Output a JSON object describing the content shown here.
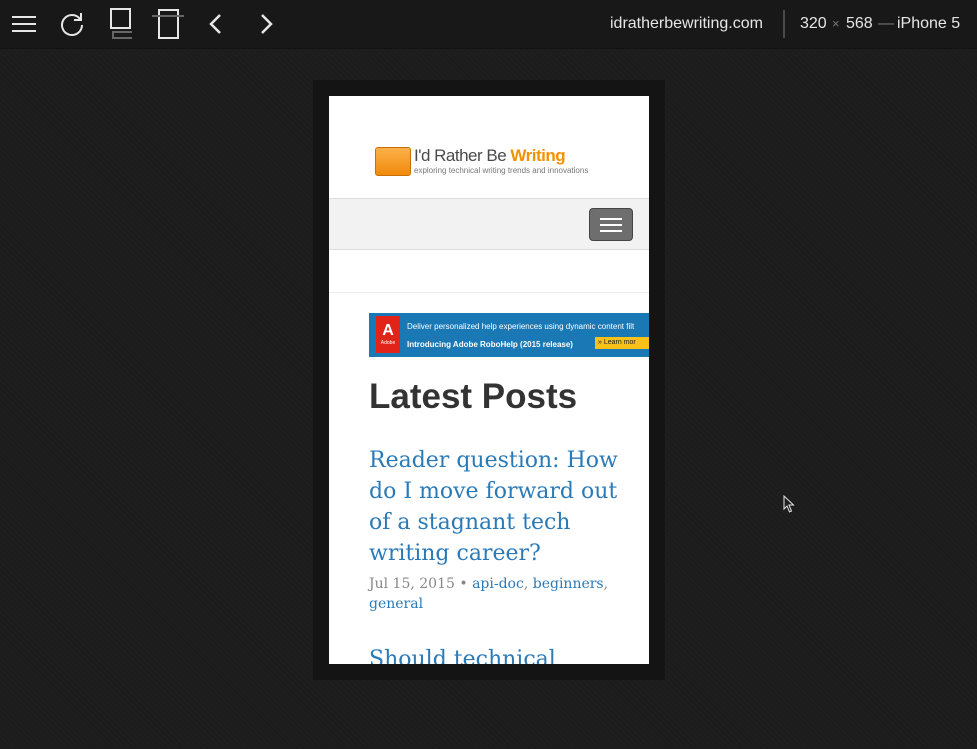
{
  "toolbar": {
    "icons": [
      "menu-icon",
      "reload-icon",
      "portrait-icon",
      "landscape-icon",
      "back-icon",
      "forward-icon"
    ],
    "site": "idratherbewriting.com",
    "width": "320",
    "times": "×",
    "height": "568",
    "dash": "—",
    "device": "iPhone 5"
  },
  "page": {
    "logo": {
      "title_prefix": "I'd Rather Be ",
      "title_accent": "Writing",
      "tagline": "exploring technical writing trends and innovations"
    },
    "ad": {
      "brand": "Adobe",
      "line1": "Deliver personalized help experiences using dynamic content filt",
      "line2": "Introducing Adobe RoboHelp (2015 release)",
      "button": "Learn mor"
    },
    "heading": "Latest Posts",
    "posts": [
      {
        "title": "Reader question: How do I move forward out of a stagnant tech writing career?",
        "date": "Jul 15, 2015",
        "sep": "•",
        "tags": [
          "api-doc",
          "beginners",
          "general"
        ]
      },
      {
        "title": "Should technical"
      }
    ]
  },
  "colors": {
    "link": "#2a7ab8",
    "accent": "#f39200",
    "ad_bg": "#1a78b5"
  }
}
